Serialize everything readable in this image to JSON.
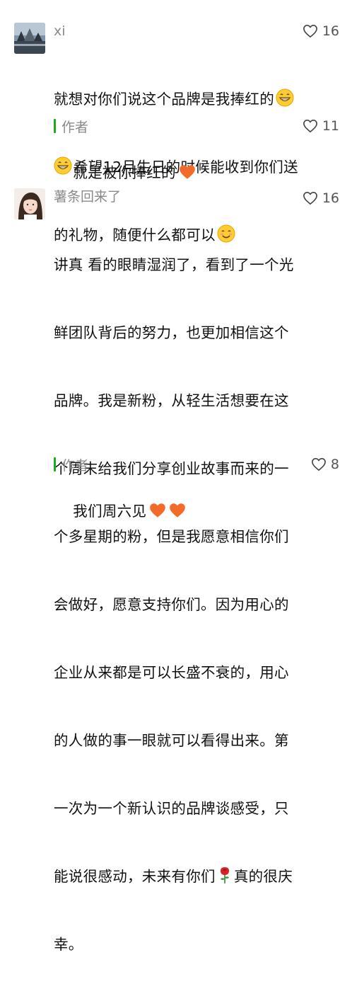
{
  "comments": [
    {
      "user": "xi",
      "likes": "16",
      "text_lines": [
        "就想对你们说这个品牌是我捧红的",
        "希望12月生日的时候能收到你们送",
        "的礼物，随便什么都可以"
      ],
      "reply": {
        "label": "作者",
        "likes": "11",
        "text": "就是被你捧红的"
      }
    },
    {
      "user": "薯条回来了",
      "likes": "16",
      "text_lines": [
        "讲真 看的眼睛湿润了，看到了一个光",
        "鲜团队背后的努力，也更加相信这个",
        "品牌。我是新粉，从轻生活想要在这",
        "个周末给我们分享创业故事而来的一",
        "个多星期的粉，但是我愿意相信你们",
        "会做好，愿意支持你们。因为用心的",
        "企业从来都是可以长盛不衰的，用心",
        "的人做的事一眼就可以看得出来。第",
        "一次为一个新认识的品牌谈感受，只",
        "能说很感动，未来有你们",
        "幸。"
      ],
      "line10_suffix": "真的很庆",
      "reply": {
        "label": "作者",
        "likes": "8",
        "text": "我们周六见"
      }
    }
  ],
  "icons": {
    "like": "heart-outline-icon",
    "grin": "grinning-emoji-icon",
    "smile": "smiling-emoji-icon",
    "heart": "orange-heart-icon",
    "rose": "rose-icon"
  },
  "colors": {
    "author_bar": "#1aad19",
    "heart": "#f26b2a"
  }
}
